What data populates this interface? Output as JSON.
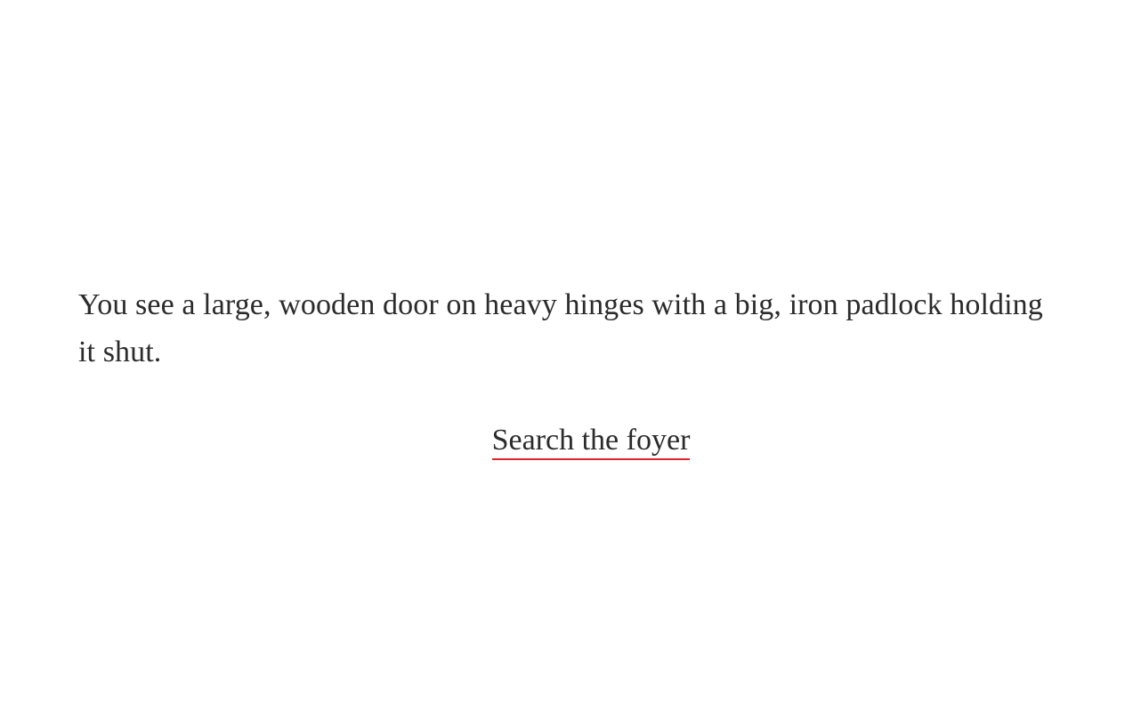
{
  "passage": {
    "text": "You see a large, wooden door on heavy hinges with a big, iron padlock holding it shut."
  },
  "choices": [
    {
      "label": "Search the foyer"
    }
  ],
  "colors": {
    "background": "#ffffff",
    "text": "#2b2b2b",
    "link_underline": "#d9252b"
  }
}
